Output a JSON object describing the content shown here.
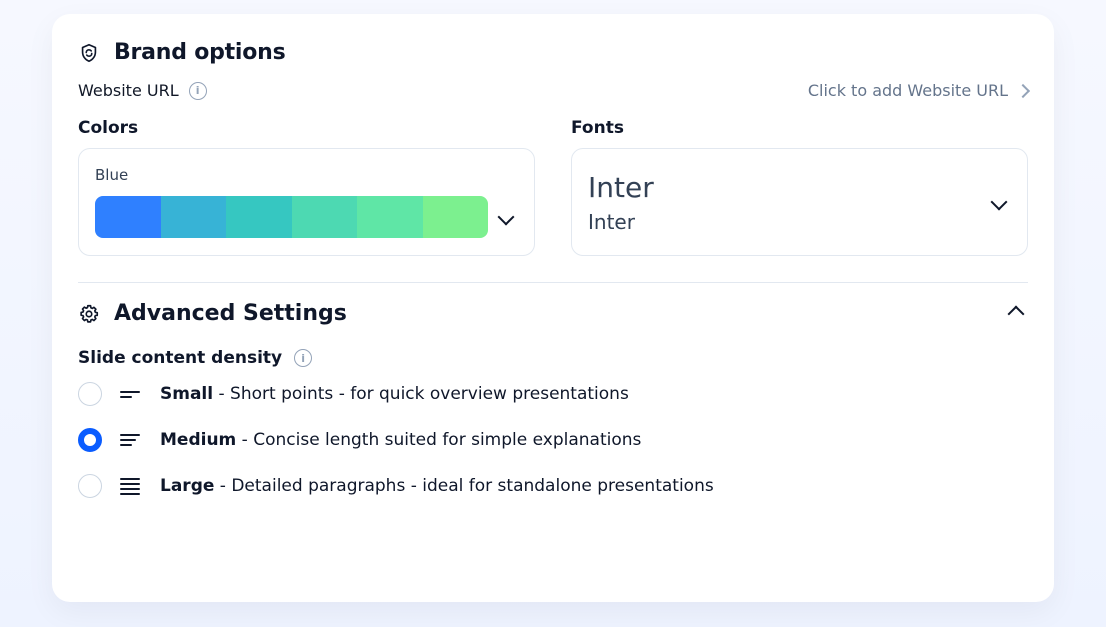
{
  "brand": {
    "title": "Brand options",
    "website_url_label": "Website URL",
    "website_url_cta": "Click to add Website URL"
  },
  "colors": {
    "label": "Colors",
    "selected_name": "Blue",
    "swatches": [
      "#2F80FF",
      "#37B3D6",
      "#36C7C1",
      "#4DD9B2",
      "#5FE6A6",
      "#7CF08F"
    ]
  },
  "fonts": {
    "label": "Fonts",
    "primary": "Inter",
    "secondary": "Inter"
  },
  "advanced": {
    "title": "Advanced Settings",
    "density_label": "Slide content density",
    "options": [
      {
        "key": "small",
        "title": "Small",
        "desc": "Short points - for quick overview presentations",
        "checked": false
      },
      {
        "key": "medium",
        "title": "Medium",
        "desc": "Concise length suited for simple explanations",
        "checked": true
      },
      {
        "key": "large",
        "title": "Large",
        "desc": "Detailed paragraphs - ideal for standalone presentations",
        "checked": false
      }
    ]
  }
}
